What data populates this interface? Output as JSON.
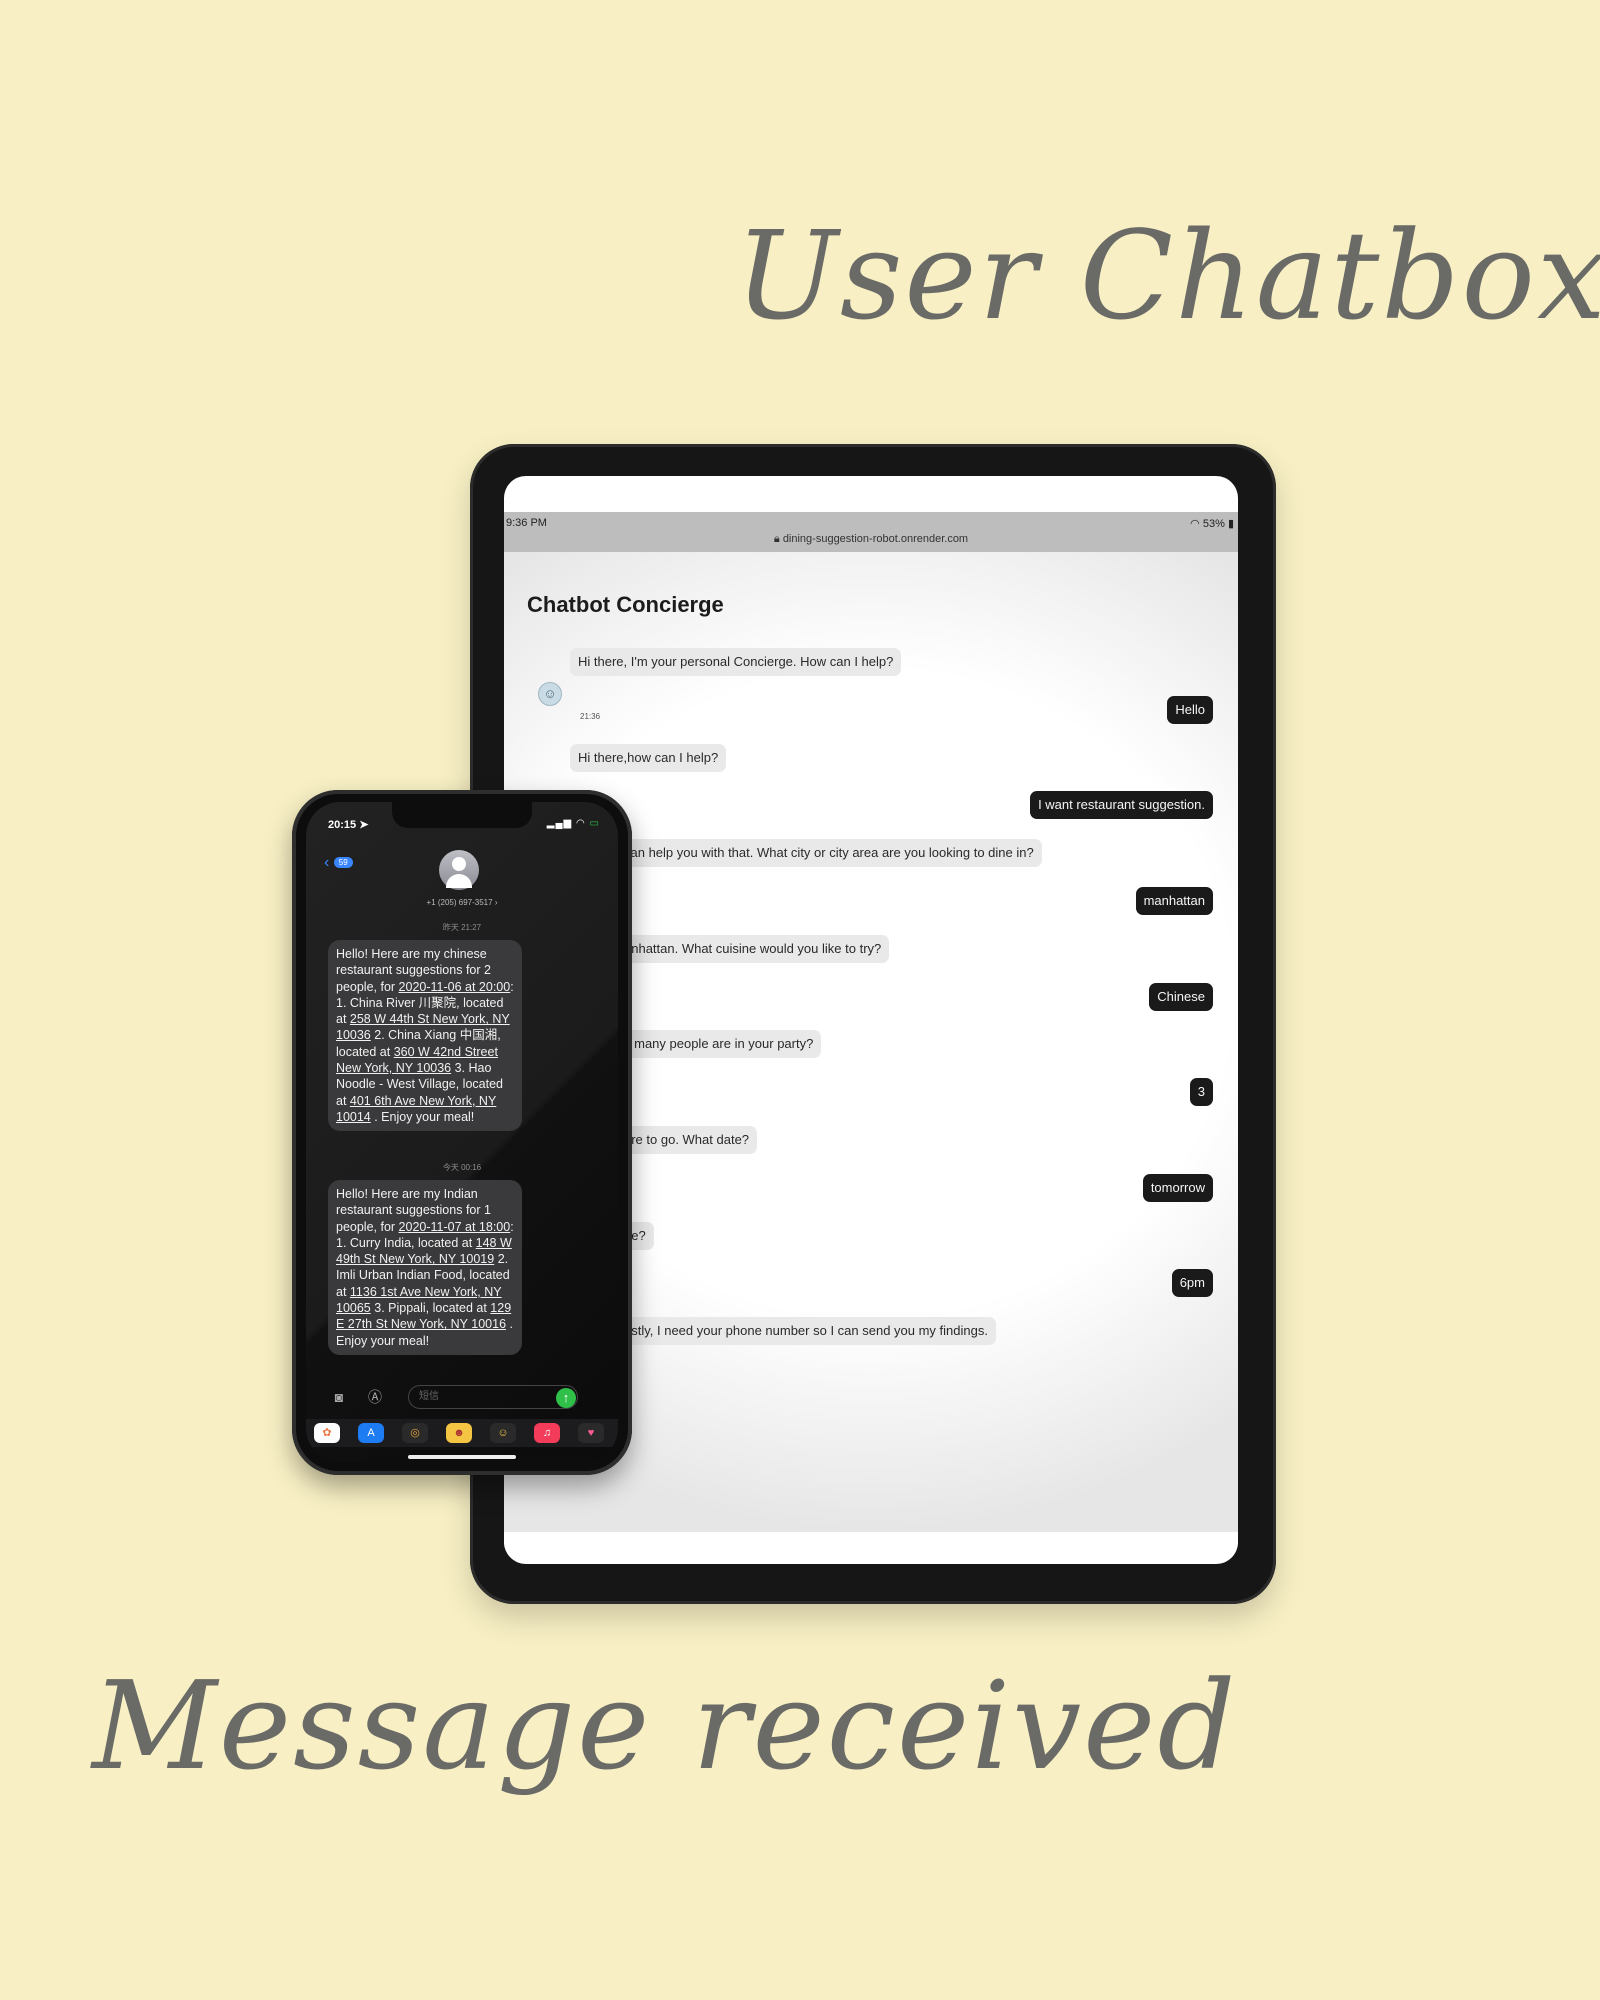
{
  "headings": {
    "top": "User Chatbox",
    "bottom": "Message received"
  },
  "tablet": {
    "status_time": "9:36 PM",
    "battery": "53%",
    "url": "dining-suggestion-robot.onrender.com",
    "app_title": "Chatbot Concierge",
    "first_timestamp": "21:36",
    "input_placeholder": "...",
    "messages": [
      {
        "from": "bot",
        "text": "Hi there, I'm your personal Concierge. How can I help?"
      },
      {
        "from": "user",
        "text": "Hello"
      },
      {
        "from": "bot",
        "text": "Hi there,how can I help?"
      },
      {
        "from": "user",
        "text": "I want restaurant suggestion."
      },
      {
        "from": "bot",
        "text": "can help you with that. What city or city area are you looking to dine in?"
      },
      {
        "from": "user",
        "text": "manhattan"
      },
      {
        "from": "bot",
        "text": "anhattan. What cuisine would you like to try?"
      },
      {
        "from": "user",
        "text": "Chinese"
      },
      {
        "from": "bot",
        "text": "v many people are in your party?"
      },
      {
        "from": "user",
        "text": "3"
      },
      {
        "from": "bot",
        "text": "ore to go. What date?"
      },
      {
        "from": "user",
        "text": "tomorrow"
      },
      {
        "from": "bot",
        "text": "ne?"
      },
      {
        "from": "user",
        "text": "6pm"
      },
      {
        "from": "bot",
        "text": "astly, I need your phone number so I can send you my findings."
      }
    ]
  },
  "phone": {
    "status_time": "20:15",
    "back_badge": "59",
    "contact_number": "+1 (205) 697-3517",
    "time_1": "昨天 21:27",
    "time_2": "今天 00:16",
    "sms_1": [
      {
        "t": "Hello! Here are my chinese restaurant suggestions for 2 people, for "
      },
      {
        "t": "2020-11-06 at 20:00",
        "link": true
      },
      {
        "t": ": 1. China River 川聚院, located at "
      },
      {
        "t": "258 W 44th St New York, NY 10036",
        "link": true
      },
      {
        "t": " 2. China Xiang 中国湘, located at "
      },
      {
        "t": "360 W 42nd Street New York, NY 10036",
        "link": true
      },
      {
        "t": " 3. Hao Noodle - West Village, located at "
      },
      {
        "t": "401 6th Ave New York, NY 10014",
        "link": true
      },
      {
        "t": " . Enjoy your meal!"
      }
    ],
    "sms_2": [
      {
        "t": "Hello! Here are my Indian restaurant suggestions for 1 people, for "
      },
      {
        "t": "2020-11-07 at 18:00",
        "link": true
      },
      {
        "t": ": 1. Curry India, located at "
      },
      {
        "t": "148 W 49th St New York, NY 10019",
        "link": true
      },
      {
        "t": " 2. Imli Urban Indian Food, located at "
      },
      {
        "t": "1136 1st Ave New York, NY 10065",
        "link": true
      },
      {
        "t": " 3. Pippali, located at "
      },
      {
        "t": "129 E 27th St New York, NY 10016",
        "link": true
      },
      {
        "t": " . Enjoy your meal!"
      }
    ],
    "compose_placeholder": "短信",
    "icons": {
      "camera": "camera-icon",
      "appstore": "app-store-icon",
      "send": "send-arrow-icon"
    }
  },
  "colors": {
    "background": "#f8f0c4",
    "heading": "#6a6a66",
    "user_bubble": "#1a1a1a",
    "bot_bubble": "#e9e9e9",
    "sms_bubble": "#3a3a3c",
    "link_blue": "#3a86ff",
    "send_green": "#30c04a"
  }
}
